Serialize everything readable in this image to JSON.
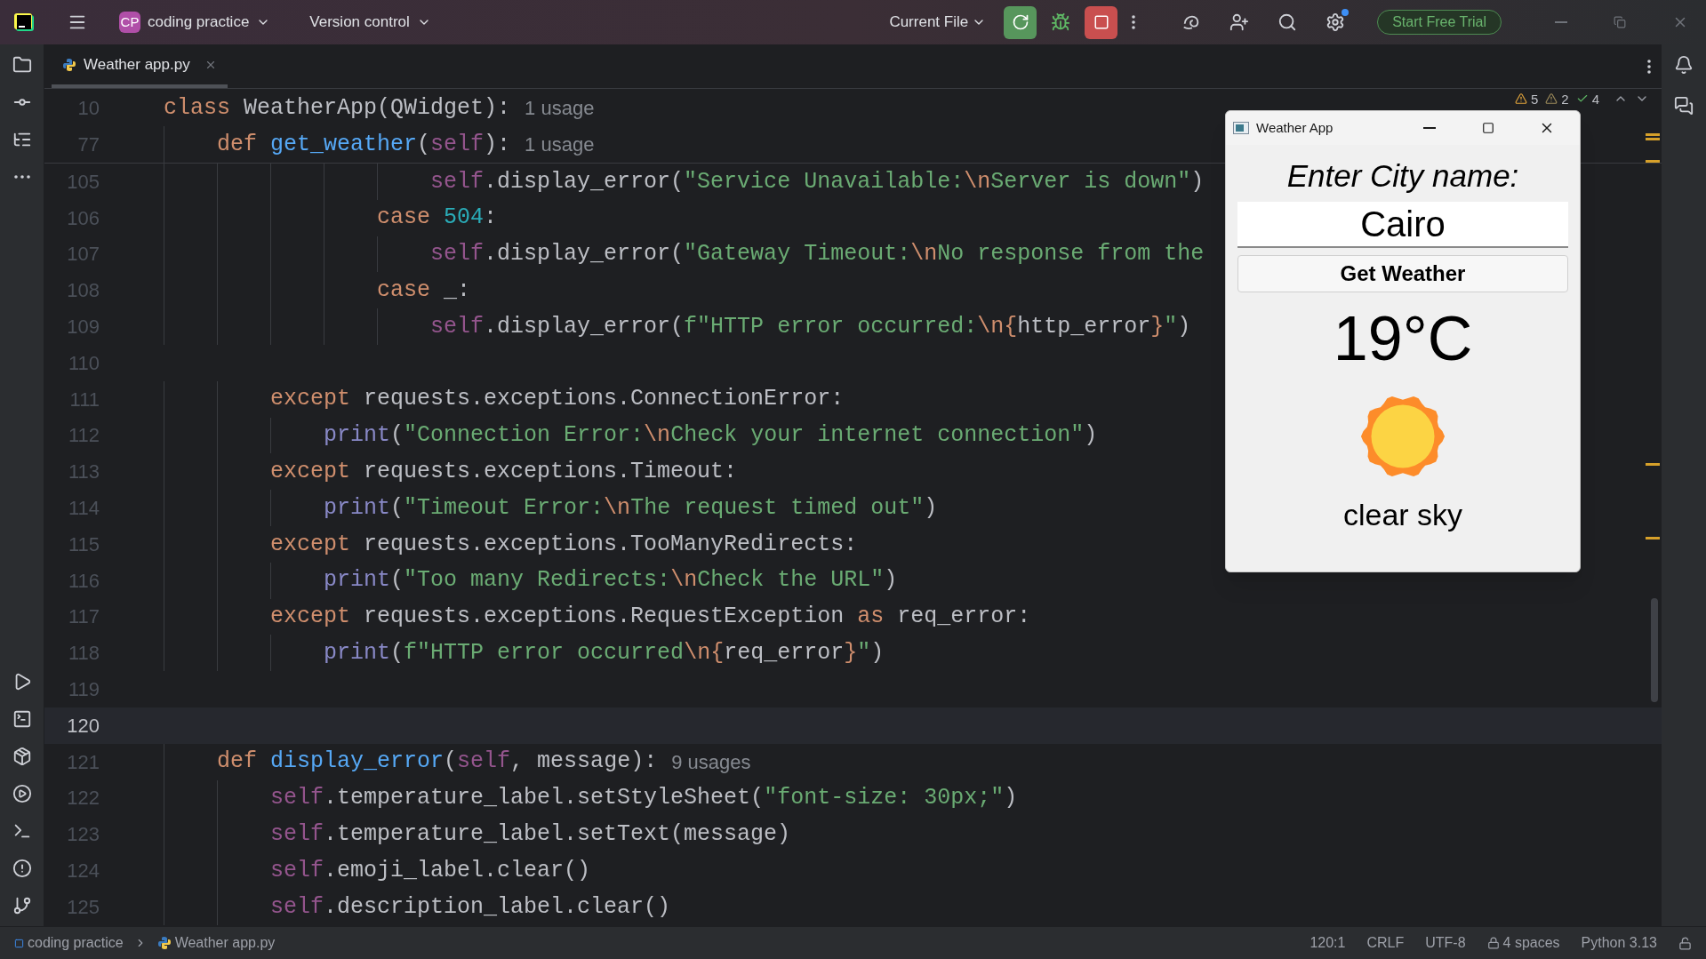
{
  "title_bar": {
    "project_badge": "CP",
    "project": "coding practice",
    "vcs": "Version control",
    "run_config": "Current File",
    "trial_button": "Start Free Trial"
  },
  "tabs": [
    {
      "label": "Weather app.py",
      "selected": true
    }
  ],
  "inspections": {
    "warnings": "5",
    "weak_warnings": "2",
    "passed": "4"
  },
  "sticky_lines": [
    {
      "number": "10",
      "hint": "1 usage",
      "tokens": [
        {
          "kind": "kw",
          "text": "class"
        },
        {
          "kind": "plain",
          "text": " WeatherApp(QWidget):"
        }
      ]
    },
    {
      "number": "77",
      "hint": "1 usage",
      "tokens": [
        {
          "kind": "kw",
          "text": "    def"
        },
        {
          "kind": "fn",
          "text": " get_weather"
        },
        {
          "kind": "plain",
          "text": "("
        },
        {
          "kind": "self",
          "text": "self"
        },
        {
          "kind": "plain",
          "text": "):"
        }
      ]
    }
  ],
  "lines": [
    {
      "number": "105",
      "current": false,
      "tokens": [
        {
          "kind": "self",
          "text": "                    self"
        },
        {
          "kind": "plain",
          "text": ".display_error("
        },
        {
          "kind": "str",
          "text": "\"Service Unavailable:"
        },
        {
          "kind": "esc",
          "text": "\\n"
        },
        {
          "kind": "str",
          "text": "Server is down\""
        },
        {
          "kind": "plain",
          "text": ")"
        }
      ]
    },
    {
      "number": "106",
      "current": false,
      "tokens": [
        {
          "kind": "kw",
          "text": "                case"
        },
        {
          "kind": "num",
          "text": " 504"
        },
        {
          "kind": "plain",
          "text": ":"
        }
      ]
    },
    {
      "number": "107",
      "current": false,
      "tokens": [
        {
          "kind": "self",
          "text": "                    self"
        },
        {
          "kind": "plain",
          "text": ".display_error("
        },
        {
          "kind": "str",
          "text": "\"Gateway Timeout:"
        },
        {
          "kind": "esc",
          "text": "\\n"
        },
        {
          "kind": "str",
          "text": "No response from the"
        }
      ]
    },
    {
      "number": "108",
      "current": false,
      "tokens": [
        {
          "kind": "kw",
          "text": "                case"
        },
        {
          "kind": "plain",
          "text": " _:"
        }
      ]
    },
    {
      "number": "109",
      "current": false,
      "tokens": [
        {
          "kind": "self",
          "text": "                    self"
        },
        {
          "kind": "plain",
          "text": ".display_error("
        },
        {
          "kind": "str",
          "text": "f\"HTTP error occurred:"
        },
        {
          "kind": "esc",
          "text": "\\n"
        },
        {
          "kind": "esc",
          "text": "{"
        },
        {
          "kind": "plain",
          "text": "http_error"
        },
        {
          "kind": "esc",
          "text": "}"
        },
        {
          "kind": "str",
          "text": "\""
        },
        {
          "kind": "plain",
          "text": ")"
        }
      ]
    },
    {
      "number": "110",
      "current": false
    },
    {
      "number": "111",
      "current": false,
      "tokens": [
        {
          "kind": "kw",
          "text": "        except"
        },
        {
          "kind": "plain",
          "text": " requests.exceptions.ConnectionError:"
        }
      ]
    },
    {
      "number": "112",
      "current": false,
      "tokens": [
        {
          "kind": "builtin",
          "text": "            print"
        },
        {
          "kind": "plain",
          "text": "("
        },
        {
          "kind": "str",
          "text": "\"Connection Error:"
        },
        {
          "kind": "esc",
          "text": "\\n"
        },
        {
          "kind": "str",
          "text": "Check your internet connection\""
        },
        {
          "kind": "plain",
          "text": ")"
        }
      ]
    },
    {
      "number": "113",
      "current": false,
      "tokens": [
        {
          "kind": "kw",
          "text": "        except"
        },
        {
          "kind": "plain",
          "text": " requests.exceptions.Timeout:"
        }
      ]
    },
    {
      "number": "114",
      "current": false,
      "tokens": [
        {
          "kind": "builtin",
          "text": "            print"
        },
        {
          "kind": "plain",
          "text": "("
        },
        {
          "kind": "str",
          "text": "\"Timeout Error:"
        },
        {
          "kind": "esc",
          "text": "\\n"
        },
        {
          "kind": "str",
          "text": "The request timed out\""
        },
        {
          "kind": "plain",
          "text": ")"
        }
      ]
    },
    {
      "number": "115",
      "current": false,
      "tokens": [
        {
          "kind": "kw",
          "text": "        except"
        },
        {
          "kind": "plain",
          "text": " requests.exceptions.TooManyRedirects:"
        }
      ]
    },
    {
      "number": "116",
      "current": false,
      "tokens": [
        {
          "kind": "builtin",
          "text": "            print"
        },
        {
          "kind": "plain",
          "text": "("
        },
        {
          "kind": "str",
          "text": "\"Too many Redirects:"
        },
        {
          "kind": "esc",
          "text": "\\n"
        },
        {
          "kind": "str",
          "text": "Check the URL\""
        },
        {
          "kind": "plain",
          "text": ")"
        }
      ]
    },
    {
      "number": "117",
      "current": false,
      "tokens": [
        {
          "kind": "kw",
          "text": "        except"
        },
        {
          "kind": "plain",
          "text": " requests.exceptions.RequestException"
        },
        {
          "kind": "kw",
          "text": " as"
        },
        {
          "kind": "plain",
          "text": " req_error:"
        }
      ]
    },
    {
      "number": "118",
      "current": false,
      "tokens": [
        {
          "kind": "builtin",
          "text": "            print"
        },
        {
          "kind": "plain",
          "text": "("
        },
        {
          "kind": "str",
          "text": "f\"HTTP error occurred"
        },
        {
          "kind": "esc",
          "text": "\\n"
        },
        {
          "kind": "esc",
          "text": "{"
        },
        {
          "kind": "plain",
          "text": "req_error"
        },
        {
          "kind": "esc",
          "text": "}"
        },
        {
          "kind": "str",
          "text": "\""
        },
        {
          "kind": "plain",
          "text": ")"
        }
      ]
    },
    {
      "number": "119",
      "current": false
    },
    {
      "number": "120",
      "current": true
    },
    {
      "number": "121",
      "current": false,
      "hint": "9 usages",
      "tokens": [
        {
          "kind": "kw",
          "text": "    def"
        },
        {
          "kind": "fn",
          "text": " display_error"
        },
        {
          "kind": "plain",
          "text": "("
        },
        {
          "kind": "self",
          "text": "self"
        },
        {
          "kind": "plain",
          "text": ", message):"
        }
      ]
    },
    {
      "number": "122",
      "current": false,
      "tokens": [
        {
          "kind": "self",
          "text": "        self"
        },
        {
          "kind": "plain",
          "text": ".temperature_label.setStyleSheet("
        },
        {
          "kind": "str",
          "text": "\"font-size: 30px;\""
        },
        {
          "kind": "plain",
          "text": ")"
        }
      ]
    },
    {
      "number": "123",
      "current": false,
      "tokens": [
        {
          "kind": "self",
          "text": "        self"
        },
        {
          "kind": "plain",
          "text": ".temperature_label.setText(message)"
        }
      ]
    },
    {
      "number": "124",
      "current": false,
      "tokens": [
        {
          "kind": "self",
          "text": "        self"
        },
        {
          "kind": "plain",
          "text": ".emoji_label.clear()"
        }
      ]
    },
    {
      "number": "125",
      "current": false,
      "tokens": [
        {
          "kind": "self",
          "text": "        self"
        },
        {
          "kind": "plain",
          "text": ".description_label.clear()"
        }
      ]
    }
  ],
  "weather_window": {
    "title": "Weather App",
    "prompt": "Enter City name:",
    "city": "Cairo",
    "button": "Get Weather",
    "temperature": "19°C",
    "description": "clear sky"
  },
  "status_bar": {
    "breadcrumbs": [
      "coding practice",
      "Weather app.py"
    ],
    "position": "120:1",
    "line_endings": "CRLF",
    "encoding": "UTF-8",
    "indent": "4 spaces",
    "interpreter": "Python 3.13"
  }
}
